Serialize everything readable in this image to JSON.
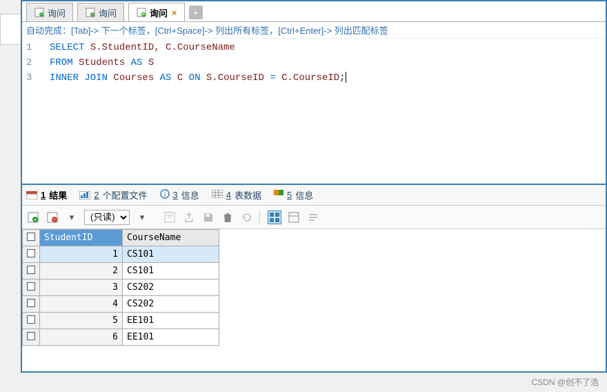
{
  "tabs": [
    {
      "label": "询问",
      "active": false
    },
    {
      "label": "询问",
      "active": false
    },
    {
      "label": "询问",
      "active": true
    }
  ],
  "hint": "自动完成：[Tab]-> 下一个标签，[Ctrl+Space]-> 列出所有标签，[Ctrl+Enter]-> 列出匹配标签",
  "sql": {
    "lines": [
      "1",
      "2",
      "3"
    ],
    "l1_kw": "SELECT",
    "l1_rest": " S.StudentID, C.CourseName",
    "l2_kw": "FROM",
    "l2_rest": " Students ",
    "l2_as": "AS",
    "l2_rest2": " S",
    "l3_kw": "INNER JOIN",
    "l3_mid": " Courses ",
    "l3_as": "AS",
    "l3_mid2": " C ",
    "l3_on": "ON",
    "l3_expr": " S.CourseID ",
    "l3_eq": "=",
    "l3_expr2": " C.CourseID",
    "l3_semi": ";"
  },
  "resultTabs": {
    "t1_num": "1",
    "t1_lbl": "结果",
    "t2_num": "2",
    "t2_lbl": "个配置文件",
    "t3_num": "3",
    "t3_lbl": "信息",
    "t4_num": "4",
    "t4_lbl": "表数据",
    "t5_num": "5",
    "t5_lbl": "信息"
  },
  "readonly": "(只读)",
  "columns": [
    "StudentID",
    "CourseName"
  ],
  "rows": [
    {
      "id": "1",
      "course": "CS101"
    },
    {
      "id": "2",
      "course": "CS101"
    },
    {
      "id": "3",
      "course": "CS202"
    },
    {
      "id": "4",
      "course": "CS202"
    },
    {
      "id": "5",
      "course": "EE101"
    },
    {
      "id": "6",
      "course": "EE101"
    }
  ],
  "watermark": "CSDN @创不了浩"
}
